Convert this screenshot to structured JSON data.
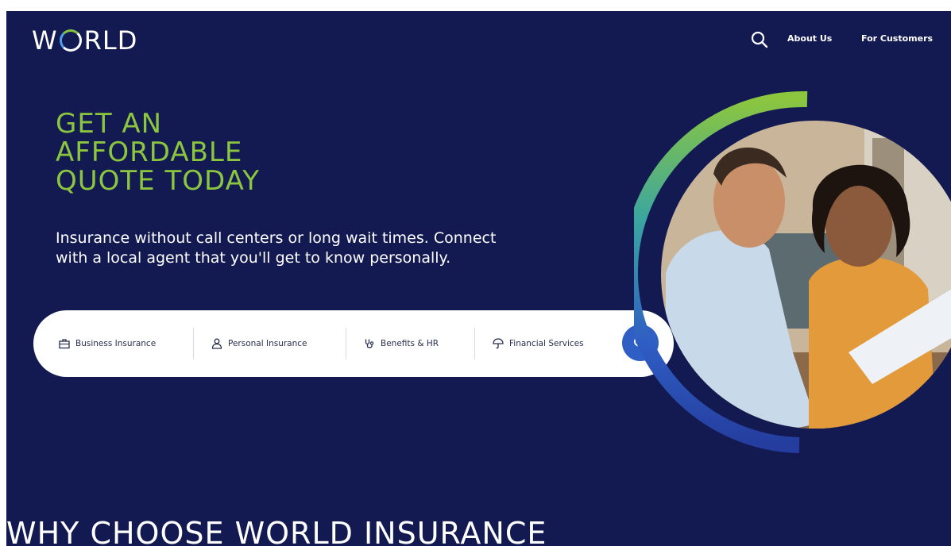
{
  "header": {
    "logo_text_before": "W",
    "logo_text_after": "RLD",
    "search_icon": "search-icon",
    "nav": [
      {
        "label": "About Us"
      },
      {
        "label": "For Customers"
      }
    ]
  },
  "hero": {
    "headline_lines": [
      "GET AN",
      "AFFORDABLE",
      "QUOTE TODAY"
    ],
    "subtext": "Insurance without call centers or long wait times. Connect with a local agent that you'll get to know personally.",
    "image_description_icon": "people-photo"
  },
  "search_bar": {
    "items": [
      {
        "label": "Business Insurance",
        "icon": "briefcase-icon"
      },
      {
        "label": "Personal Insurance",
        "icon": "person-icon"
      },
      {
        "label": "Benefits & HR",
        "icon": "stethoscope-icon"
      },
      {
        "label": "Financial Services",
        "icon": "umbrella-icon"
      }
    ],
    "submit_icon": "search-icon"
  },
  "section": {
    "heading": "WHY CHOOSE WORLD INSURANCE"
  },
  "colors": {
    "background": "#131a52",
    "accent_green": "#8cc63f",
    "accent_blue": "#2f5ec4"
  }
}
